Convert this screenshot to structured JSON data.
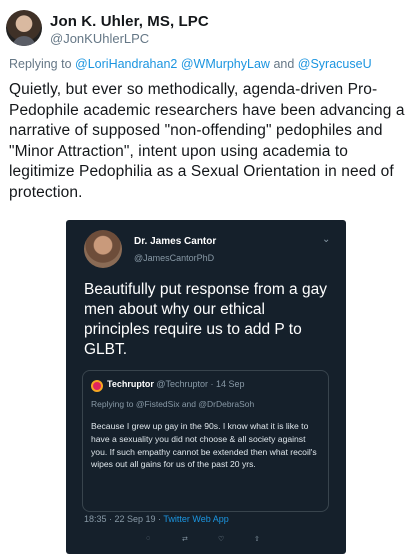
{
  "author": {
    "display_name": "Jon K. Uhler, MS, LPC",
    "handle": "@JonKUhlerLPC"
  },
  "reply": {
    "prefix": "Replying to",
    "mentions": "@LoriHandrahan2 @WMurphyLaw",
    "and": "and",
    "last": "@SyracuseU"
  },
  "body": "Quietly, but ever so methodically, agenda-driven Pro-Pedophile academic researchers have been advancing a narrative of supposed \"non-offending\" pedophiles and \"Minor Attraction\", intent upon using academia to legitimize Pedophilia as a Sexual Orientation in need of protection.",
  "embedded": {
    "name": "Dr. James Cantor",
    "handle": "@JamesCantorPhD",
    "chevron": "⌄",
    "text": "Beautifully put response from a gay men about why our ethical principles require us to add P to GLBT.",
    "quote": {
      "name": "Techruptor",
      "meta": "@Techruptor · 14 Sep",
      "reply": "Replying to @FistedSix and @DrDebraSoh",
      "text": "Because I grew up gay in the 90s. I know what it is like to have a sexuality you did not choose & all society against you. If such empathy cannot be extended then what recoil's wipes out all gains for us of the past 20 yrs."
    },
    "timestamp": "18:35 · 22 Sep 19 ·",
    "source": "Twitter Web App"
  },
  "colors": {
    "link": "#1b95e0",
    "dark_bg": "#15202b",
    "muted": "#657786"
  }
}
